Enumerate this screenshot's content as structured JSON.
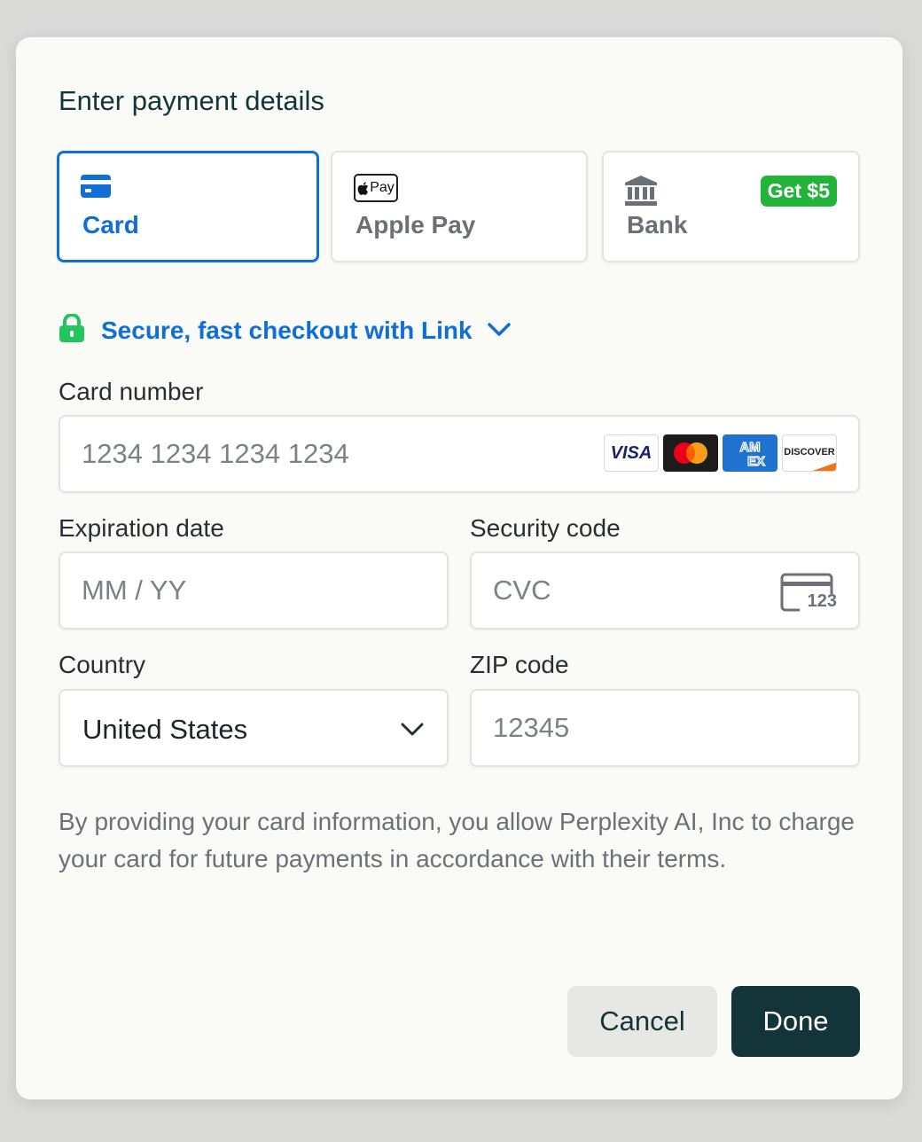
{
  "dialog": {
    "title": "Enter payment details"
  },
  "tabs": [
    {
      "label": "Card",
      "selected": true,
      "icon": "credit-card-icon"
    },
    {
      "label": "Apple Pay",
      "selected": false,
      "icon": "apple-pay-icon",
      "icon_text": "Pay"
    },
    {
      "label": "Bank",
      "selected": false,
      "icon": "bank-icon",
      "badge": "Get $5"
    }
  ],
  "link": {
    "text": "Secure, fast checkout with Link",
    "icon": "lock-icon"
  },
  "card_number": {
    "label": "Card number",
    "placeholder": "1234 1234 1234 1234",
    "brands": [
      "VISA",
      "mastercard",
      "AMEX",
      "DISCOVER"
    ]
  },
  "expiration": {
    "label": "Expiration date",
    "placeholder": "MM / YY"
  },
  "security": {
    "label": "Security code",
    "placeholder": "CVC",
    "icon_text": "123"
  },
  "country": {
    "label": "Country",
    "value": "United States"
  },
  "zip": {
    "label": "ZIP code",
    "placeholder": "12345"
  },
  "consent": "By providing your card information, you allow Perplexity AI, Inc to charge your card for future payments in accordance with their terms.",
  "buttons": {
    "cancel": "Cancel",
    "done": "Done"
  },
  "colors": {
    "accent": "#0f6fd6",
    "badge": "#22b33a",
    "primary_button": "#13353a",
    "lock": "#22c55e"
  }
}
